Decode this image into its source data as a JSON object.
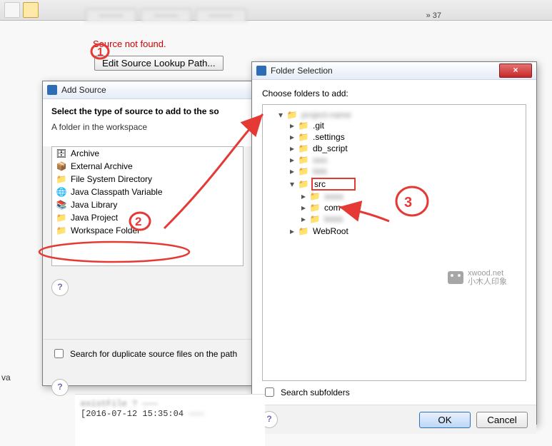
{
  "toolbar": {
    "snf": "Source not found.",
    "edit_lookup": "Edit Source Lookup Path...",
    "badge": "37"
  },
  "add_source": {
    "title": "Add Source",
    "heading_full": "Select the type of source to add to the source lookup path",
    "heading_visible": "Select the type of source to add to the so",
    "subheading": "A folder in the workspace",
    "items": [
      "Archive",
      "External Archive",
      "File System Directory",
      "Java Classpath Variable",
      "Java Library",
      "Java Project",
      "Workspace Folder"
    ],
    "dup_check_full": "Search for duplicate source files on the path",
    "dup_check_visible": "Search for duplicate source files on the path"
  },
  "folder_sel": {
    "title": "Folder Selection",
    "choose": "Choose folders to add:",
    "tree": {
      "root": "(project)",
      "children": [
        {
          "label": ".git"
        },
        {
          "label": ".settings"
        },
        {
          "label": "db_script"
        },
        {
          "label": "(hidden)"
        },
        {
          "label": "(hidden)"
        },
        {
          "label": "src",
          "highlight": true,
          "children": [
            {
              "label": "(hidden)"
            },
            {
              "label": "com"
            },
            {
              "label": "(hidden)"
            }
          ]
        },
        {
          "label": "WebRoot"
        }
      ]
    },
    "sub_check": "Search subfolders",
    "ok": "OK",
    "cancel": "Cancel"
  },
  "tabs": [
    "———",
    "———",
    "———"
  ],
  "watermark": {
    "text1": "xwood.net",
    "text2": "小木人印象"
  },
  "left_label": "va",
  "console_line": "[2016-07-12 15:35:04"
}
